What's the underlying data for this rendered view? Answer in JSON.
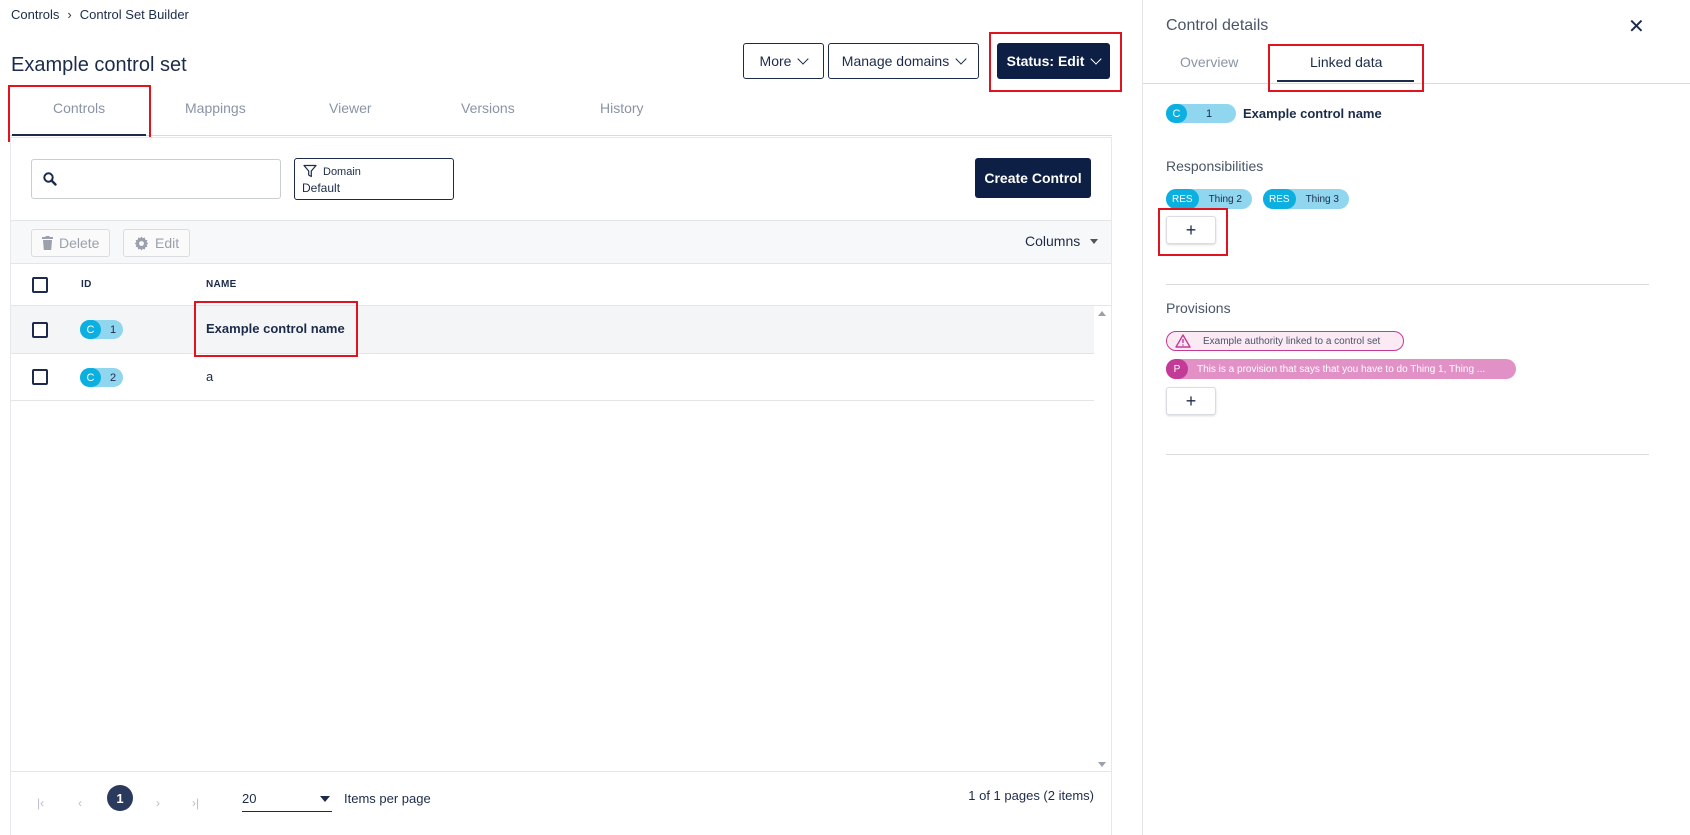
{
  "breadcrumb": {
    "root": "Controls",
    "current": "Control Set Builder"
  },
  "page_title": "Example control set",
  "header_buttons": {
    "more": "More",
    "manage_domains": "Manage domains",
    "status": "Status: Edit"
  },
  "tabs": [
    "Controls",
    "Mappings",
    "Viewer",
    "Versions",
    "History"
  ],
  "filter": {
    "label": "Domain",
    "value": "Default"
  },
  "create_button": "Create Control",
  "toolbar": {
    "delete": "Delete",
    "edit": "Edit",
    "columns": "Columns"
  },
  "table": {
    "headers": {
      "id": "ID",
      "name": "NAME"
    },
    "rows": [
      {
        "prefix": "C",
        "id": "1",
        "name": "Example control name"
      },
      {
        "prefix": "C",
        "id": "2",
        "name": "a"
      }
    ]
  },
  "pager": {
    "first": "|‹",
    "prev": "‹",
    "current": "1",
    "next": "›",
    "last": "›|",
    "page_size": "20",
    "page_size_label": "Items per page",
    "info": "1 of 1 pages (2 items)"
  },
  "panel": {
    "title": "Control details",
    "tabs": [
      "Overview",
      "Linked data"
    ],
    "control": {
      "prefix": "C",
      "id": "1",
      "name": "Example control name"
    },
    "responsibilities_title": "Responsibilities",
    "responsibilities": [
      {
        "tag": "RES",
        "label": "Thing 2"
      },
      {
        "tag": "RES",
        "label": "Thing 3"
      }
    ],
    "add": "+",
    "provisions_title": "Provisions",
    "authority": "Example authority linked to a control set",
    "provision": {
      "tag": "P",
      "label": "This is a provision that says that you have to do Thing 1, Thing ..."
    }
  },
  "colors": {
    "navy": "#0e1f45",
    "cyan": "#0bb0e0",
    "cyan_light": "#8fd6ee",
    "magenta": "#c23b97",
    "highlight": "#e0141e"
  }
}
